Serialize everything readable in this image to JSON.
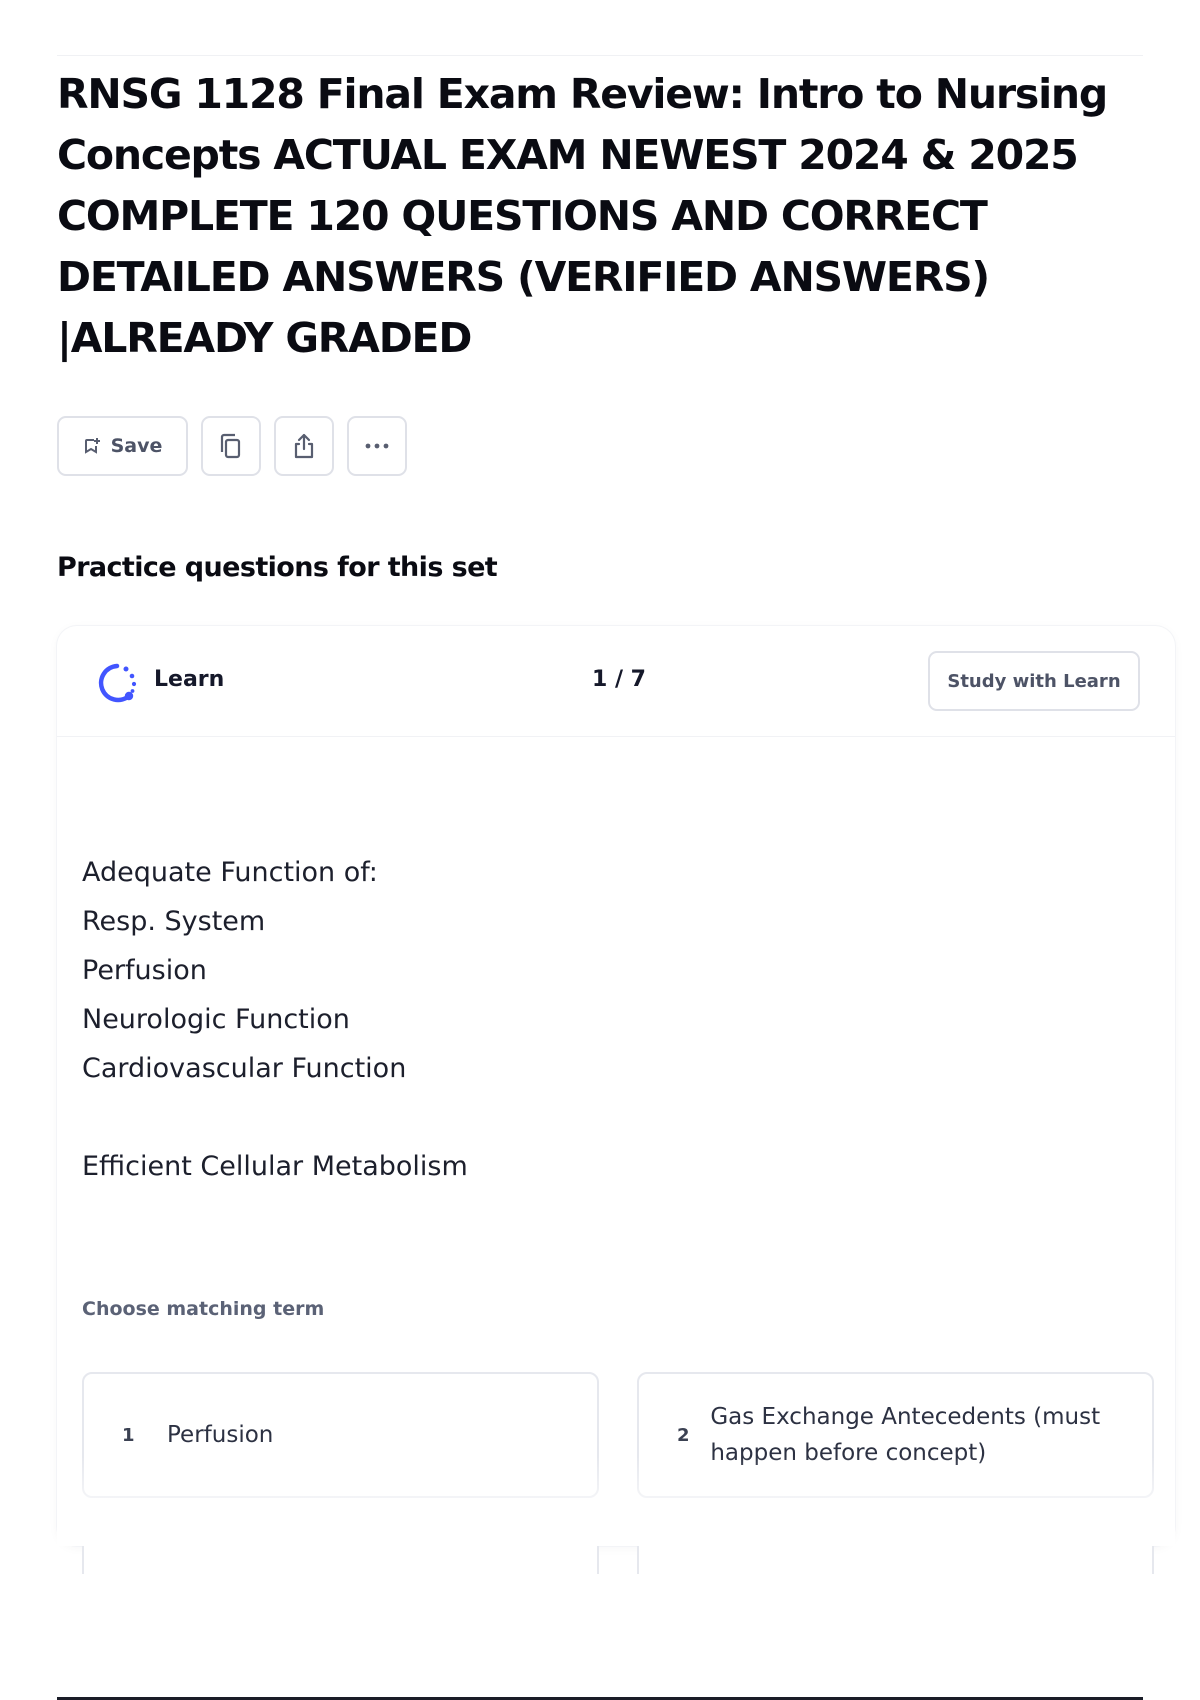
{
  "page": {
    "title": "RNSG 1128 Final Exam Review: Intro to Nursing Concepts ACTUAL EXAM NEWEST 2024 & 2025 COMPLETE 120 QUESTIONS AND CORRECT DETAILED ANSWERS (VERIFIED ANSWERS) |ALREADY GRADED"
  },
  "toolbar": {
    "save_label": "Save",
    "icons": [
      "save-icon",
      "copy-icon",
      "share-icon",
      "more-icon"
    ]
  },
  "practice": {
    "heading": "Practice questions for this set",
    "learn_label": "Learn",
    "progress": "1 / 7",
    "study_button": "Study with Learn",
    "prompt_lines": [
      "Adequate Function of:",
      "Resp. System",
      "Perfusion",
      "Neurologic Function",
      "Cardiovascular Function",
      "Efficient Cellular Metabolism"
    ],
    "choose_label": "Choose matching term",
    "options": [
      {
        "number": "1",
        "text": "Perfusion"
      },
      {
        "number": "2",
        "text": "Gas Exchange Antecedents (must happen before concept)"
      }
    ]
  },
  "colors": {
    "learn_brand": "#4255ff",
    "border": "#dfe1e8",
    "title_text": "#0a0b12",
    "muted_text": "#5b6276"
  }
}
